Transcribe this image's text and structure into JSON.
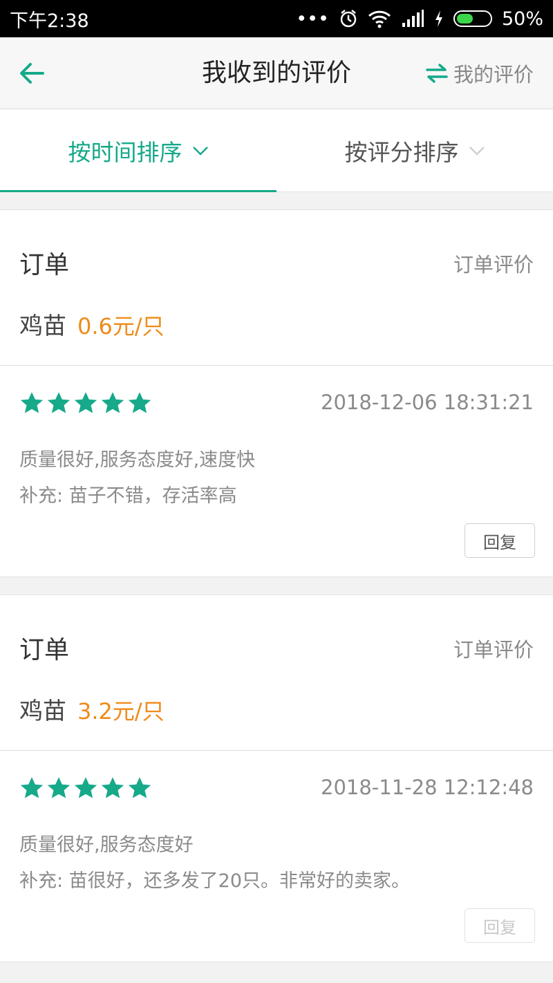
{
  "status_bar": {
    "time": "下午2:38",
    "battery": "50%",
    "battery_level": 0.5
  },
  "header": {
    "title": "我收到的评价",
    "switch_label": "我的评价"
  },
  "tabs": [
    {
      "label": "按时间排序",
      "active": true
    },
    {
      "label": "按评分排序",
      "active": false
    }
  ],
  "reviews": [
    {
      "order_label": "订单",
      "order_review_link": "订单评价",
      "product": "鸡苗",
      "price": "0.6元/只",
      "rating": 5,
      "date": "2018-12-06 18:31:21",
      "comment": "质量很好,服务态度好,速度快",
      "supplement": "补充: 苗子不错，存活率高",
      "reply_label": "回复",
      "reply_enabled": true
    },
    {
      "order_label": "订单",
      "order_review_link": "订单评价",
      "product": "鸡苗",
      "price": "3.2元/只",
      "rating": 5,
      "date": "2018-11-28 12:12:48",
      "comment": "质量很好,服务态度好",
      "supplement": "补充: 苗很好，还多发了20只。非常好的卖家。",
      "reply_label": "回复",
      "reply_enabled": false
    }
  ],
  "colors": {
    "accent": "#16a98a",
    "price": "#f08a19",
    "star": "#16a98a"
  }
}
